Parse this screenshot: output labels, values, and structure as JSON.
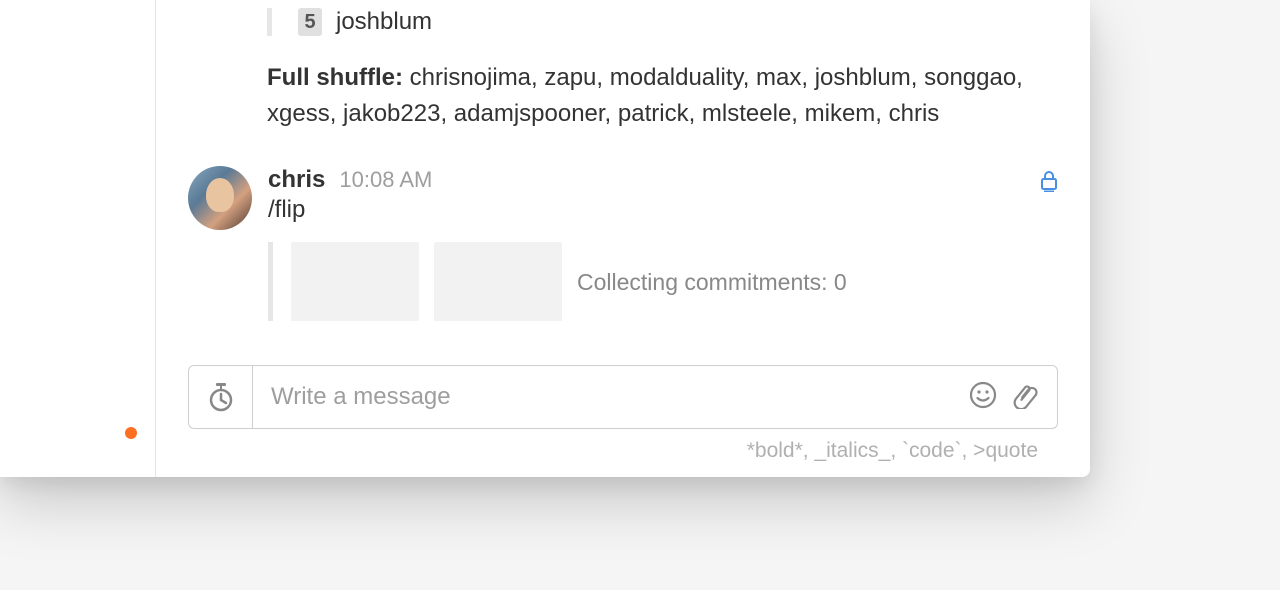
{
  "previous_message": {
    "shuffle_items": [
      {
        "rank": "5",
        "name": "joshblum"
      }
    ],
    "full_shuffle_label": "Full shuffle:",
    "full_shuffle_list": "chrisnojima, zapu, modalduality, max, joshblum, songgao, xgess, jakob223, adamjspooner, patrick, mlsteele, mikem, chris"
  },
  "message": {
    "author": "chris",
    "time": "10:08 AM",
    "text": "/flip",
    "flip_status_label": "Collecting commitments:",
    "flip_status_count": "0"
  },
  "composer": {
    "placeholder": "Write a message",
    "format_hint": "*bold*, _italics_, `code`, >quote"
  }
}
